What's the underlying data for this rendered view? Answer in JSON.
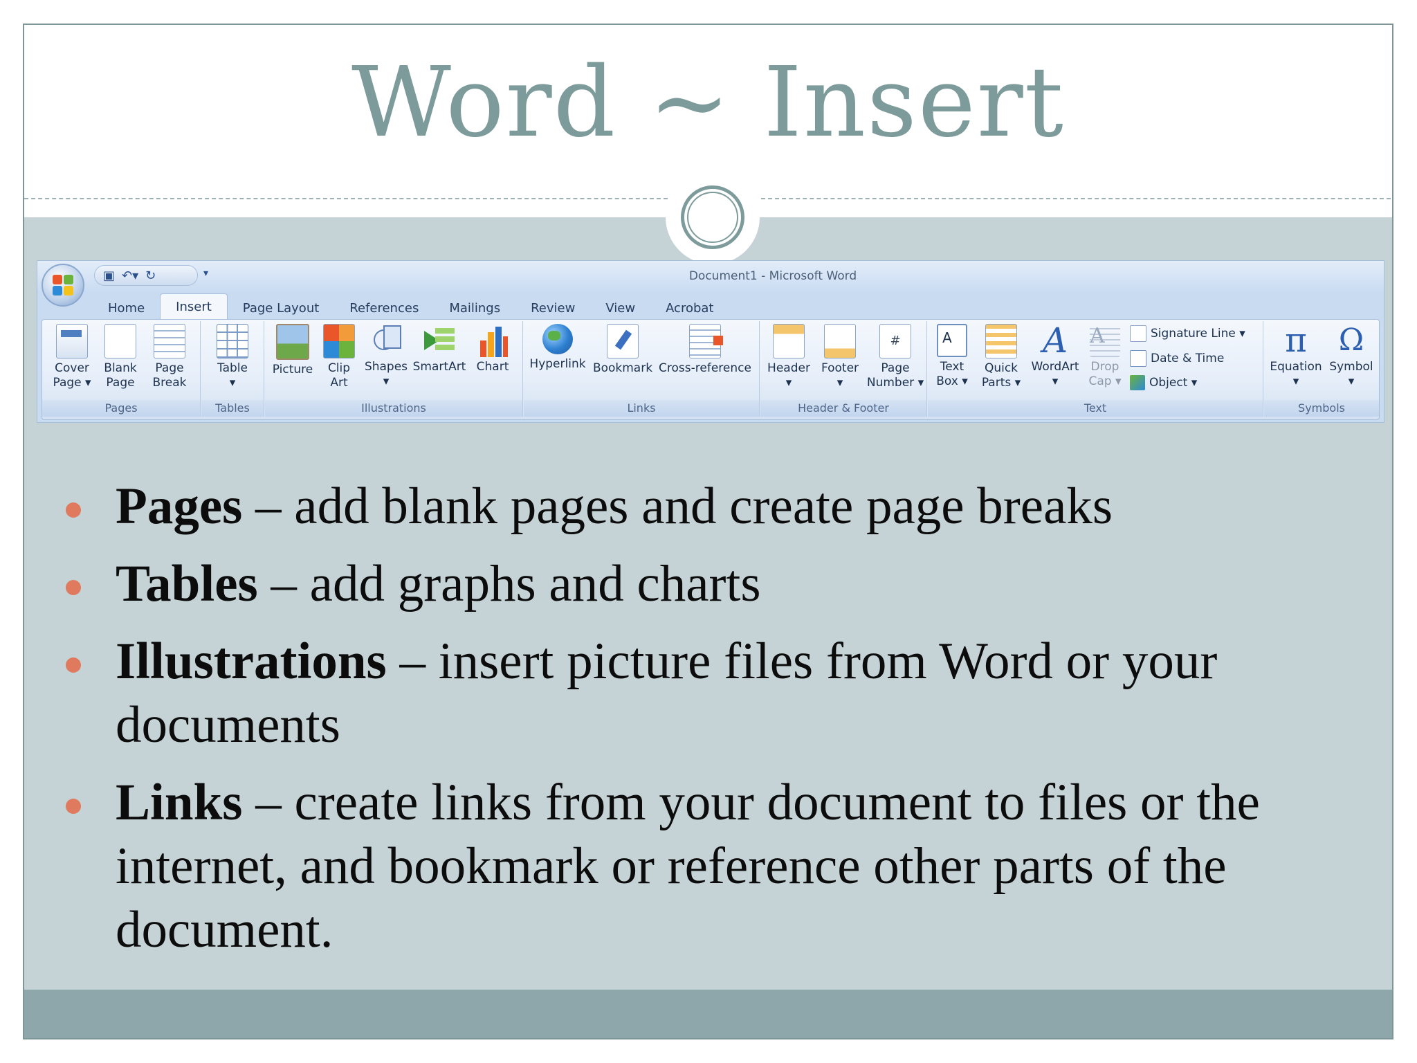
{
  "slide": {
    "title": "Word ~ Insert"
  },
  "ribbon": {
    "window_title": "Document1 - Microsoft Word",
    "qat_more": "▾",
    "tabs": [
      {
        "label": "Home"
      },
      {
        "label": "Insert",
        "active": true
      },
      {
        "label": "Page Layout"
      },
      {
        "label": "References"
      },
      {
        "label": "Mailings"
      },
      {
        "label": "Review"
      },
      {
        "label": "View"
      },
      {
        "label": "Acrobat"
      }
    ],
    "groups": {
      "pages": {
        "label": "Pages",
        "buttons": [
          {
            "line1": "Cover",
            "line2": "Page ▾",
            "icon": "cover-page-icon"
          },
          {
            "line1": "Blank",
            "line2": "Page",
            "icon": "blank-page-icon"
          },
          {
            "line1": "Page",
            "line2": "Break",
            "icon": "page-break-icon"
          }
        ]
      },
      "tables": {
        "label": "Tables",
        "buttons": [
          {
            "line1": "Table",
            "line2": "▾",
            "icon": "table-icon"
          }
        ]
      },
      "illustrations": {
        "label": "Illustrations",
        "buttons": [
          {
            "line1": "Picture",
            "line2": "",
            "icon": "picture-icon"
          },
          {
            "line1": "Clip",
            "line2": "Art",
            "icon": "clip-art-icon"
          },
          {
            "line1": "Shapes",
            "line2": "▾",
            "icon": "shapes-icon"
          },
          {
            "line1": "SmartArt",
            "line2": "",
            "icon": "smartart-icon"
          },
          {
            "line1": "Chart",
            "line2": "",
            "icon": "chart-icon"
          }
        ]
      },
      "links": {
        "label": "Links",
        "buttons": [
          {
            "line1": "Hyperlink",
            "line2": "",
            "icon": "hyperlink-globe-icon"
          },
          {
            "line1": "Bookmark",
            "line2": "",
            "icon": "bookmark-icon"
          },
          {
            "line1": "Cross-reference",
            "line2": "",
            "icon": "cross-reference-icon"
          }
        ]
      },
      "header_footer": {
        "label": "Header & Footer",
        "buttons": [
          {
            "line1": "Header",
            "line2": "▾",
            "icon": "header-icon"
          },
          {
            "line1": "Footer",
            "line2": "▾",
            "icon": "footer-icon"
          },
          {
            "line1": "Page",
            "line2": "Number ▾",
            "icon": "page-number-icon"
          }
        ]
      },
      "text": {
        "label": "Text",
        "buttons": [
          {
            "line1": "Text",
            "line2": "Box ▾",
            "icon": "text-box-icon"
          },
          {
            "line1": "Quick",
            "line2": "Parts ▾",
            "icon": "quick-parts-icon"
          },
          {
            "line1": "WordArt",
            "line2": "▾",
            "icon": "wordart-icon"
          },
          {
            "line1": "Drop",
            "line2": "Cap ▾",
            "icon": "drop-cap-icon"
          }
        ],
        "small_buttons": [
          {
            "label": "Signature Line ▾",
            "icon": "signature-line-icon"
          },
          {
            "label": "Date & Time",
            "icon": "date-time-icon"
          },
          {
            "label": "Object ▾",
            "icon": "object-icon"
          }
        ]
      },
      "symbols": {
        "label": "Symbols",
        "buttons": [
          {
            "line1": "Equation",
            "line2": "▾",
            "glyph": "π",
            "icon": "equation-pi-icon"
          },
          {
            "line1": "Symbol",
            "line2": "▾",
            "glyph": "Ω",
            "icon": "symbol-omega-icon"
          }
        ]
      }
    }
  },
  "bullets": [
    {
      "term": "Pages",
      "text": " – add blank pages and create page breaks"
    },
    {
      "term": "Tables",
      "text": " – add graphs and charts"
    },
    {
      "term": "Illustrations",
      "text": " – insert picture files from Word or your documents"
    },
    {
      "term": "Links",
      "text": " – create links from your document to files or the internet, and bookmark or reference other parts of the document."
    }
  ],
  "colors": {
    "title": "#7d9b9b",
    "content_bg": "#c5d3d6",
    "footer_band": "#8ea7aa",
    "bullet_dot": "#e07a5f"
  }
}
